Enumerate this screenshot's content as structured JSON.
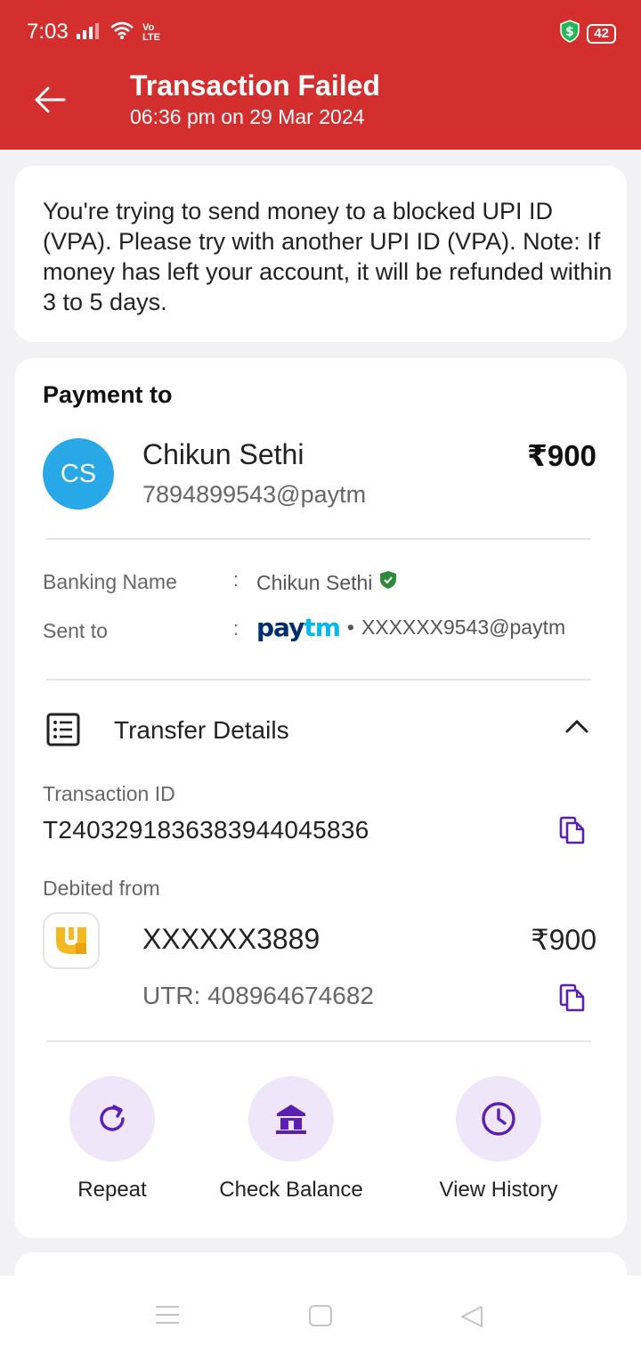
{
  "status_bar": {
    "time": "7:03",
    "network": "Vo LTE",
    "battery": "42"
  },
  "header": {
    "title": "Transaction Failed",
    "subtitle": "06:36 pm on 29 Mar 2024",
    "color": "#d32f2f"
  },
  "message": "You're trying to send money to a blocked UPI ID (VPA). Please try with another UPI ID (VPA). Note: If money has left your account, it will be refunded within 3 to 5 days.",
  "payment": {
    "heading": "Payment to",
    "avatar_initials": "CS",
    "payee_name": "Chikun Sethi",
    "payee_vpa": "7894899543@paytm",
    "amount": "₹900",
    "banking_name_label": "Banking Name",
    "banking_name_value": "Chikun Sethi",
    "sent_to_label": "Sent to",
    "sent_to_logo": "paytm",
    "sent_to_value": "XXXXXX9543@paytm",
    "colon": ":"
  },
  "transfer": {
    "title": "Transfer Details",
    "txn_label": "Transaction ID",
    "txn_id": "T2403291836383944045836",
    "debited_label": "Debited from",
    "account": "XXXXXX3889",
    "amount": "₹900",
    "utr": "UTR: 408964674682"
  },
  "actions": [
    {
      "label": "Repeat",
      "icon": "refresh-icon"
    },
    {
      "label": "Check Balance",
      "icon": "bank-icon"
    },
    {
      "label": "View History",
      "icon": "clock-icon"
    }
  ],
  "accent_color": "#5b1fb3"
}
